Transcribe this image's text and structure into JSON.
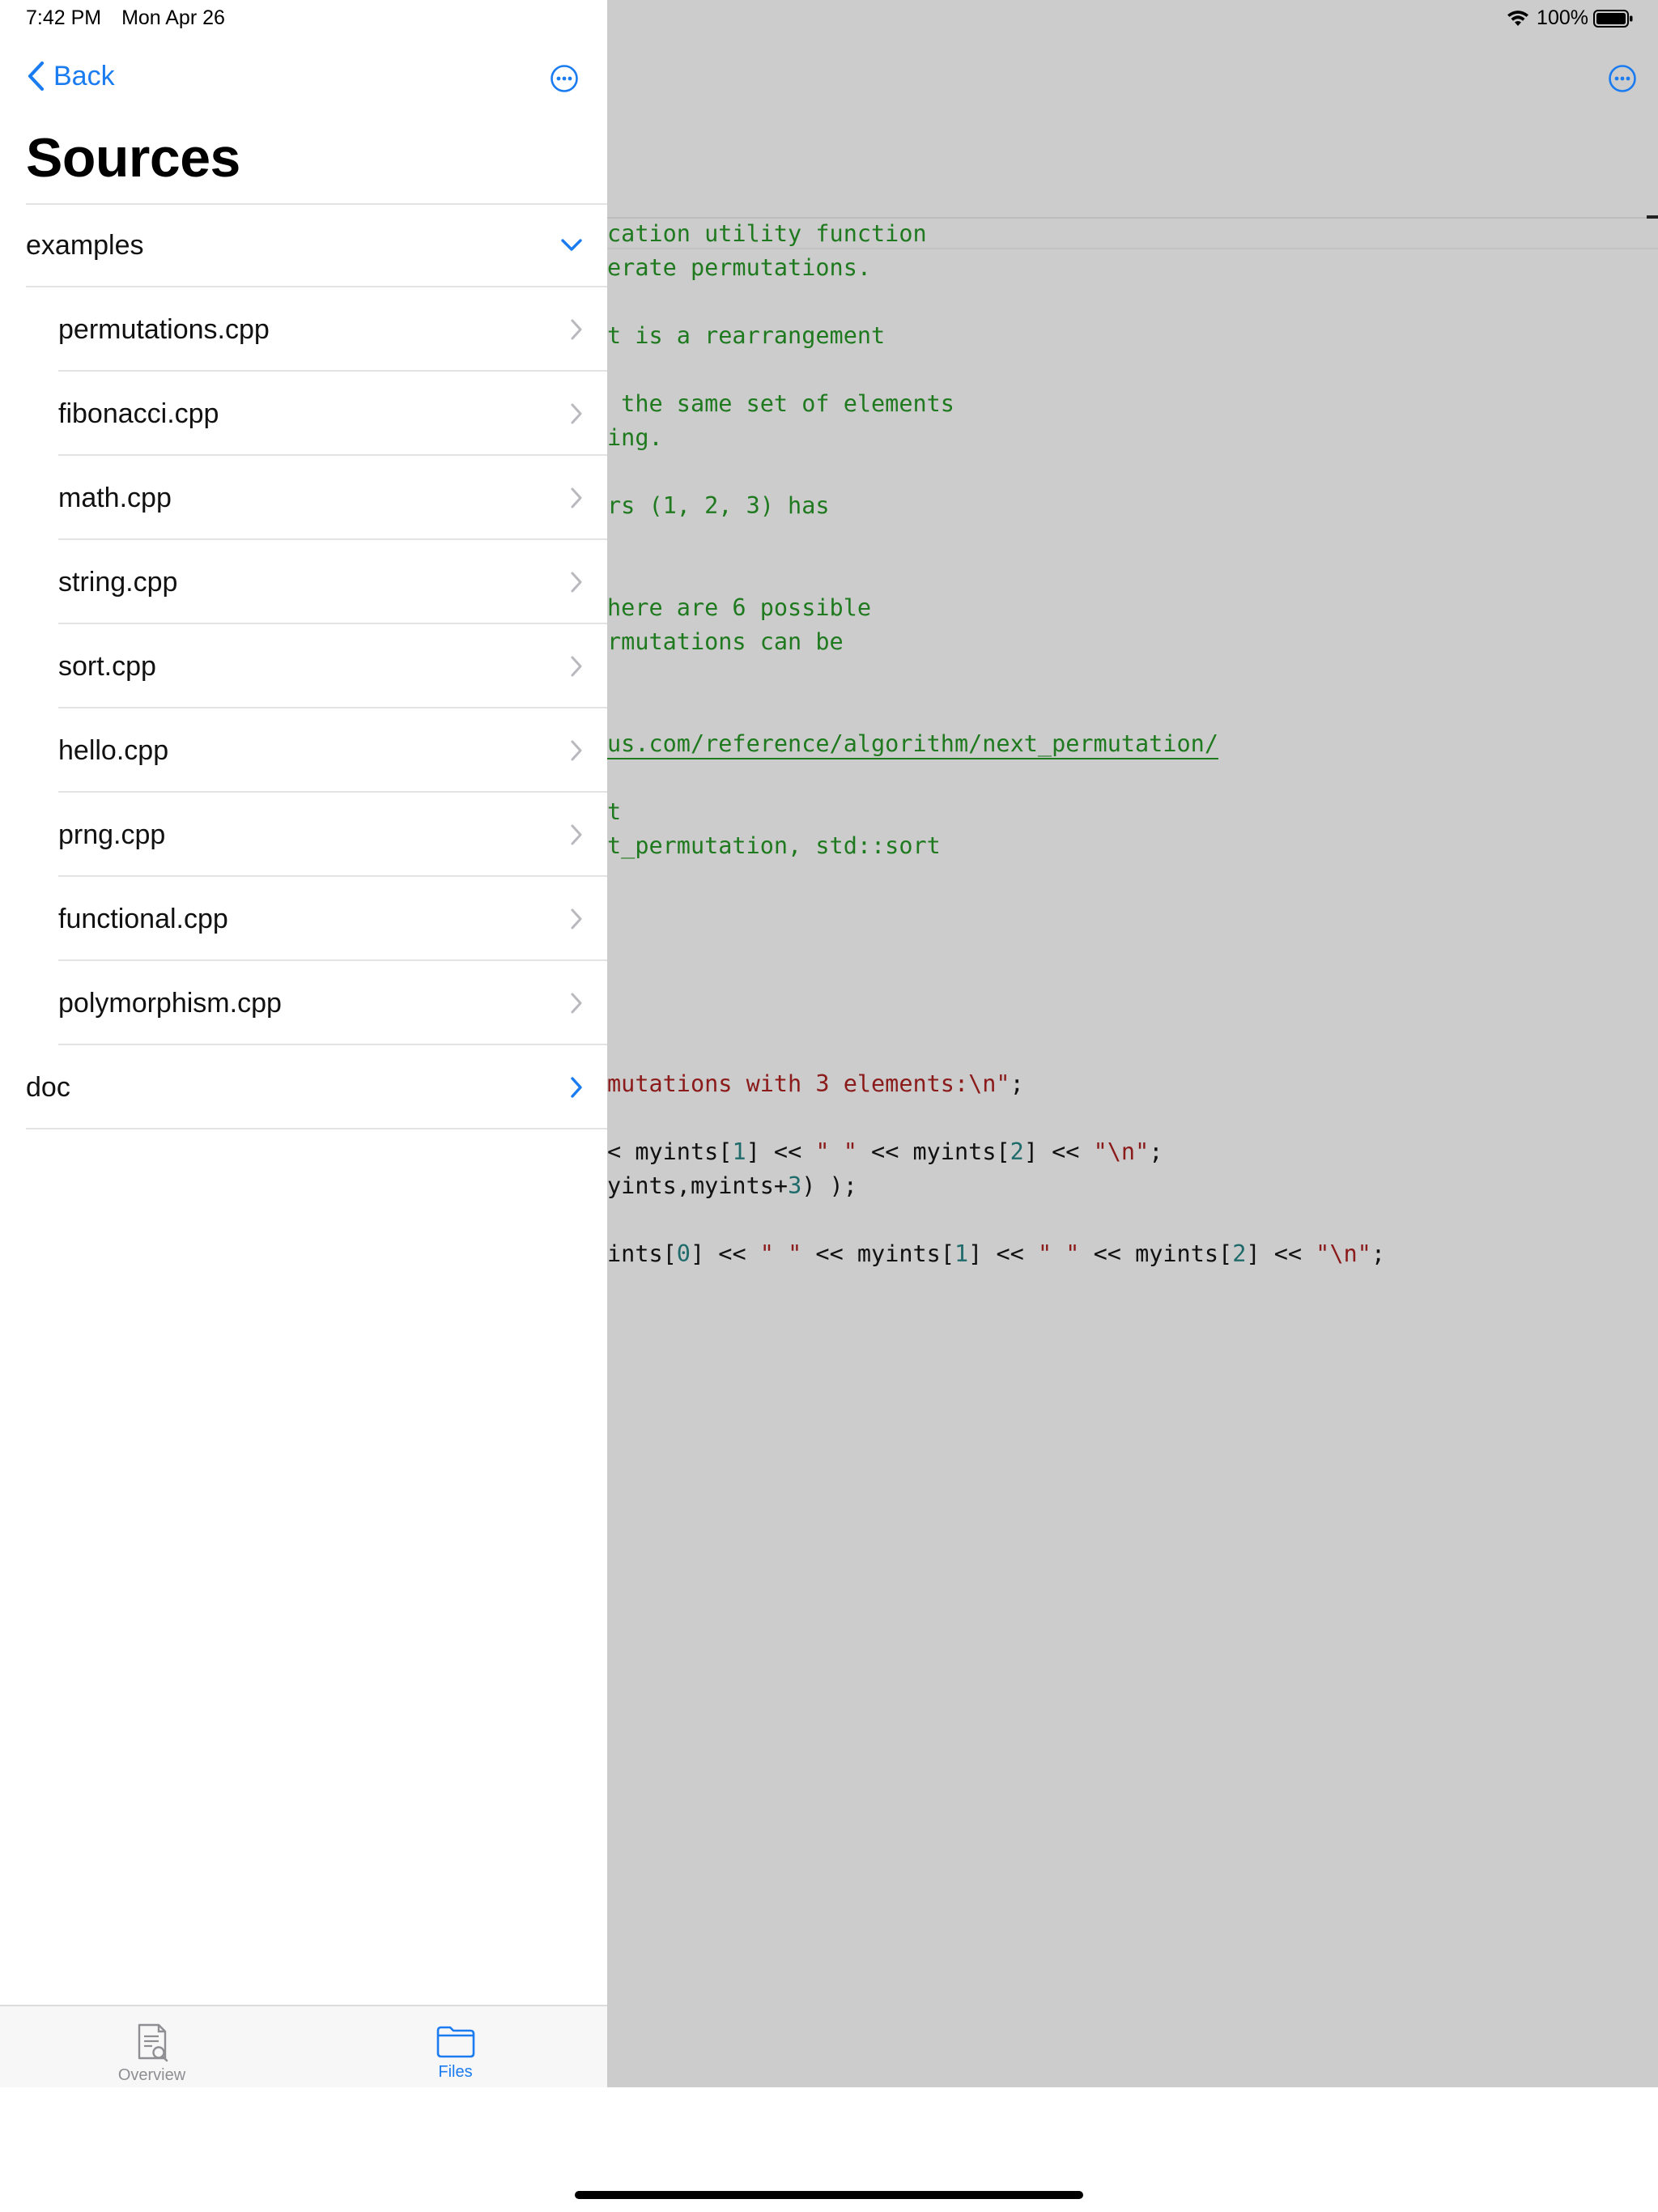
{
  "status_bar": {
    "time": "7:42 PM",
    "date": "Mon Apr 26",
    "battery": "100%",
    "wifi_icon": "wifi-icon",
    "battery_icon": "battery-full-icon"
  },
  "sidebar": {
    "back_label": "Back",
    "title": "Sources",
    "items": [
      {
        "label": "examples",
        "type": "folder",
        "expanded": true
      },
      {
        "label": "permutations.cpp",
        "type": "file"
      },
      {
        "label": "fibonacci.cpp",
        "type": "file"
      },
      {
        "label": "math.cpp",
        "type": "file"
      },
      {
        "label": "string.cpp",
        "type": "file"
      },
      {
        "label": "sort.cpp",
        "type": "file"
      },
      {
        "label": "hello.cpp",
        "type": "file"
      },
      {
        "label": "prng.cpp",
        "type": "file"
      },
      {
        "label": "functional.cpp",
        "type": "file"
      },
      {
        "label": "polymorphism.cpp",
        "type": "file"
      },
      {
        "label": "doc",
        "type": "folder",
        "expanded": false
      }
    ]
  },
  "tabbar": {
    "tabs": [
      {
        "label": "Overview",
        "icon": "document-search-icon",
        "active": false
      },
      {
        "label": "Files",
        "icon": "folder-icon",
        "active": true
      }
    ]
  },
  "editor": {
    "lines": [
      [
        {
          "t": "cation utility function",
          "c": "comment"
        }
      ],
      [
        {
          "t": "erate permutations.",
          "c": "comment"
        }
      ],
      [],
      [
        {
          "t": "t is a rearrangement",
          "c": "comment"
        }
      ],
      [],
      [
        {
          "t": " the same set of elements",
          "c": "comment"
        }
      ],
      [
        {
          "t": "ing.",
          "c": "comment"
        }
      ],
      [],
      [
        {
          "t": "rs (1, 2, 3) has",
          "c": "comment"
        }
      ],
      [],
      [],
      [
        {
          "t": "here are 6 possible",
          "c": "comment"
        }
      ],
      [
        {
          "t": "rmutations can be",
          "c": "comment"
        }
      ],
      [],
      [],
      [
        {
          "t": "us.com/reference/algorithm/next_permutation/",
          "c": "link"
        }
      ],
      [],
      [
        {
          "t": "t",
          "c": "comment"
        }
      ],
      [
        {
          "t": "t_permutation, std::sort",
          "c": "comment"
        }
      ],
      [],
      [],
      [],
      [],
      [],
      [],
      [
        {
          "t": "mutations with 3 elements:\\n\"",
          "c": "str"
        },
        {
          "t": ";",
          "c": "plain"
        }
      ],
      [],
      [
        {
          "t": "< myints[",
          "c": "plain"
        },
        {
          "t": "1",
          "c": "num"
        },
        {
          "t": "] << ",
          "c": "plain"
        },
        {
          "t": "\" \"",
          "c": "str"
        },
        {
          "t": " << myints[",
          "c": "plain"
        },
        {
          "t": "2",
          "c": "num"
        },
        {
          "t": "] << ",
          "c": "plain"
        },
        {
          "t": "\"\\n\"",
          "c": "str"
        },
        {
          "t": ";",
          "c": "plain"
        }
      ],
      [
        {
          "t": "yints,myints+",
          "c": "plain"
        },
        {
          "t": "3",
          "c": "num"
        },
        {
          "t": ") );",
          "c": "plain"
        }
      ],
      [],
      [
        {
          "t": "ints[",
          "c": "plain"
        },
        {
          "t": "0",
          "c": "num"
        },
        {
          "t": "] << ",
          "c": "plain"
        },
        {
          "t": "\" \"",
          "c": "str"
        },
        {
          "t": " << myints[",
          "c": "plain"
        },
        {
          "t": "1",
          "c": "num"
        },
        {
          "t": "] << ",
          "c": "plain"
        },
        {
          "t": "\" \"",
          "c": "str"
        },
        {
          "t": " << myints[",
          "c": "plain"
        },
        {
          "t": "2",
          "c": "num"
        },
        {
          "t": "] << ",
          "c": "plain"
        },
        {
          "t": "\"\\n\"",
          "c": "str"
        },
        {
          "t": ";",
          "c": "plain"
        }
      ]
    ]
  },
  "colors": {
    "accent": "#1a7cf0",
    "comment": "#1f7a1f",
    "string": "#8b1a1a",
    "number": "#1f6b6b",
    "editor_background": "#cccccc"
  }
}
